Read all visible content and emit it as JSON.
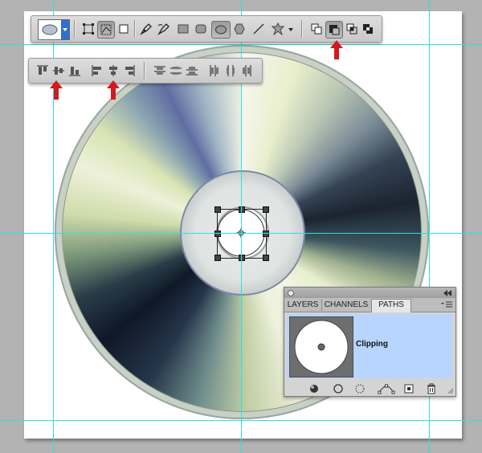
{
  "toolbar_primary": {
    "tools": [
      {
        "name": "ellipse-preset-picker"
      },
      {
        "name": "shape-layers-mode"
      },
      {
        "name": "paths-mode"
      },
      {
        "name": "fill-pixels-mode"
      },
      {
        "name": "pen-tool"
      },
      {
        "name": "freeform-pen-tool"
      },
      {
        "name": "rectangle-tool"
      },
      {
        "name": "rounded-rectangle-tool"
      },
      {
        "name": "ellipse-tool"
      },
      {
        "name": "polygon-tool"
      },
      {
        "name": "line-tool"
      },
      {
        "name": "custom-shape-tool"
      },
      {
        "name": "add-to-path-area"
      },
      {
        "name": "subtract-from-path-area"
      },
      {
        "name": "intersect-path-areas"
      },
      {
        "name": "exclude-overlapping-path-areas"
      }
    ]
  },
  "toolbar_align": {
    "tools": [
      {
        "name": "align-top-edges"
      },
      {
        "name": "align-vertical-centers"
      },
      {
        "name": "align-bottom-edges"
      },
      {
        "name": "align-left-edges"
      },
      {
        "name": "align-horizontal-centers"
      },
      {
        "name": "align-right-edges"
      },
      {
        "name": "distribute-top-edges"
      },
      {
        "name": "distribute-vertical-centers"
      },
      {
        "name": "distribute-bottom-edges"
      },
      {
        "name": "distribute-left-edges"
      },
      {
        "name": "distribute-horizontal-centers"
      },
      {
        "name": "distribute-right-edges"
      }
    ]
  },
  "paths_panel": {
    "tabs": [
      {
        "label": "LAYERS",
        "active": false
      },
      {
        "label": "CHANNELS",
        "active": false
      },
      {
        "label": "PATHS",
        "active": true
      }
    ],
    "path_items": [
      {
        "label": "Clipping"
      }
    ],
    "footer_icons": [
      "fill-path-icon",
      "stroke-path-icon",
      "load-as-selection-icon",
      "make-work-path-icon",
      "new-path-icon",
      "trash-icon"
    ]
  },
  "colors": {
    "guide": "#2de0e0",
    "arrow": "#d11a1f",
    "selected_row": "#b7d5ff"
  }
}
